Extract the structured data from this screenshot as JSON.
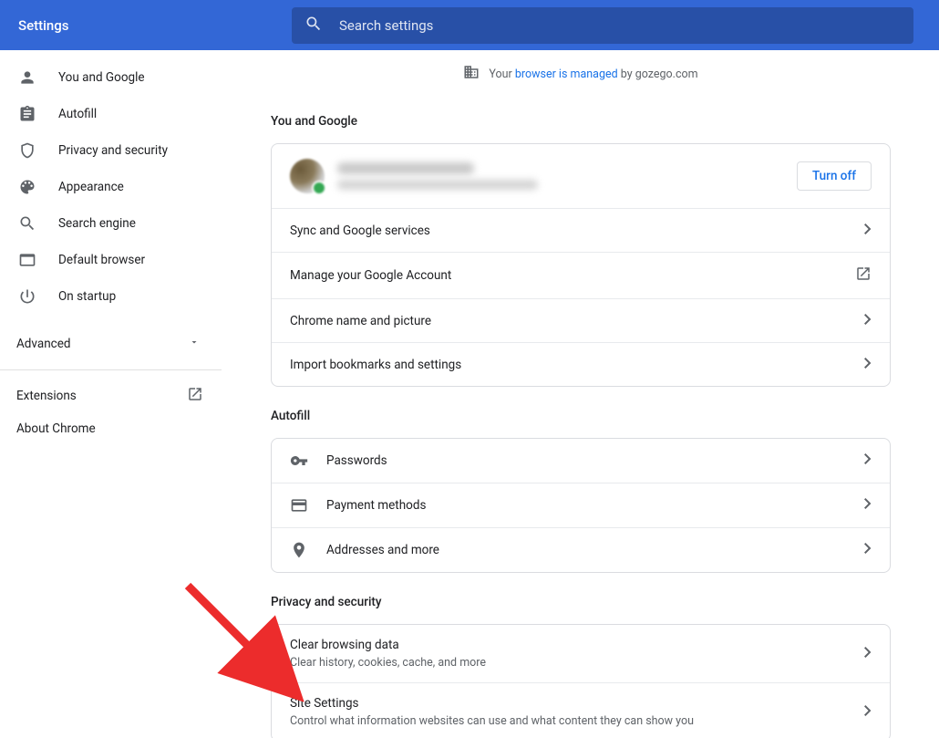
{
  "header": {
    "title": "Settings",
    "search_placeholder": "Search settings"
  },
  "sidebar": {
    "items": [
      {
        "label": "You and Google"
      },
      {
        "label": "Autofill"
      },
      {
        "label": "Privacy and security"
      },
      {
        "label": "Appearance"
      },
      {
        "label": "Search engine"
      },
      {
        "label": "Default browser"
      },
      {
        "label": "On startup"
      }
    ],
    "advanced_label": "Advanced",
    "extensions_label": "Extensions",
    "about_label": "About Chrome"
  },
  "managed": {
    "prefix": "Your ",
    "link": "browser is managed",
    "suffix": " by gozego.com"
  },
  "sections": {
    "you_google": {
      "title": "You and Google",
      "turn_off": "Turn off",
      "rows": {
        "sync": "Sync and Google services",
        "manage": "Manage your Google Account",
        "name_pic": "Chrome name and picture",
        "import": "Import bookmarks and settings"
      }
    },
    "autofill": {
      "title": "Autofill",
      "rows": {
        "passwords": "Passwords",
        "payment": "Payment methods",
        "addresses": "Addresses and more"
      }
    },
    "privacy": {
      "title": "Privacy and security",
      "rows": {
        "clear": {
          "title": "Clear browsing data",
          "sub": "Clear history, cookies, cache, and more"
        },
        "site": {
          "title": "Site Settings",
          "sub": "Control what information websites can use and what content they can show you"
        }
      }
    }
  }
}
